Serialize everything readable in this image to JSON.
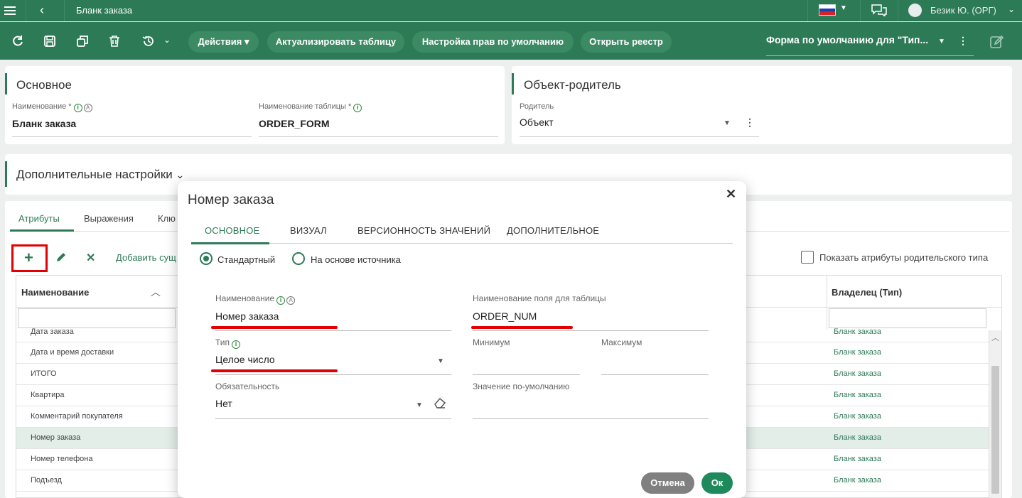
{
  "app": {
    "title": "Бланк заказа",
    "user": "Безик Ю. (ОРГ)",
    "colors": {
      "primary": "#2d7a57",
      "highlight": "#e20000"
    }
  },
  "toolbar": {
    "actions_label": "Действия",
    "refresh_table_label": "Актуализировать таблицу",
    "default_rights_label": "Настройка прав по умолчанию",
    "open_registry_label": "Открыть реестр",
    "form_selector": "Форма по умолчанию для \"Тип...",
    "icons": [
      "refresh-icon",
      "save-icon",
      "copy-icon",
      "delete-icon",
      "history-icon",
      "edit-icon"
    ]
  },
  "basic": {
    "title": "Основное",
    "name_label": "Наименование *",
    "name_value": "Бланк заказа",
    "table_name_label": "Наименование таблицы *",
    "table_name_value": "ORDER_FORM"
  },
  "parent": {
    "title": "Объект-родитель",
    "label": "Родитель",
    "value": "Объект"
  },
  "extra": {
    "title": "Дополнительные настройки"
  },
  "bottom_tabs": [
    "Атрибуты",
    "Выражения",
    "Клю"
  ],
  "attributes": {
    "add_sub_label": "Добавить сущ",
    "show_parent_label": "Показать атрибуты родительского типа",
    "columns": {
      "name": "Наименование",
      "owner": "Владелец (Тип)"
    },
    "rows": [
      {
        "name": "Дата заказа",
        "owner": "Бланк заказа"
      },
      {
        "name": "Дата и время доставки",
        "owner": "Бланк заказа"
      },
      {
        "name": "ИТОГО",
        "owner": "Бланк заказа"
      },
      {
        "name": "Квартира",
        "owner": "Бланк заказа"
      },
      {
        "name": "Комментарий покупателя",
        "owner": "Бланк заказа"
      },
      {
        "name": "Номер заказа",
        "owner": "Бланк заказа"
      },
      {
        "name": "Номер телефона",
        "owner": "Бланк заказа"
      },
      {
        "name": "Подъезд",
        "owner": "Бланк заказа"
      }
    ]
  },
  "modal": {
    "title": "Номер заказа",
    "tabs": [
      "ОСНОВНОЕ",
      "ВИЗУАЛ",
      "ВЕРСИОННОСТЬ ЗНАЧЕНИЙ",
      "ДОПОЛНИТЕЛЬНОЕ"
    ],
    "radio_standard": "Стандартный",
    "radio_source": "На основе источника",
    "name_label": "Наименование",
    "name_value": "Номер заказа",
    "field_name_label": "Наименование поля для таблицы",
    "field_name_value": "ORDER_NUM",
    "type_label": "Тип",
    "type_value": "Целое число",
    "min_label": "Минимум",
    "max_label": "Максимум",
    "required_label": "Обязательность",
    "required_value": "Нет",
    "default_label": "Значение по-умолчанию",
    "cancel_label": "Отмена",
    "ok_label": "Ок"
  }
}
